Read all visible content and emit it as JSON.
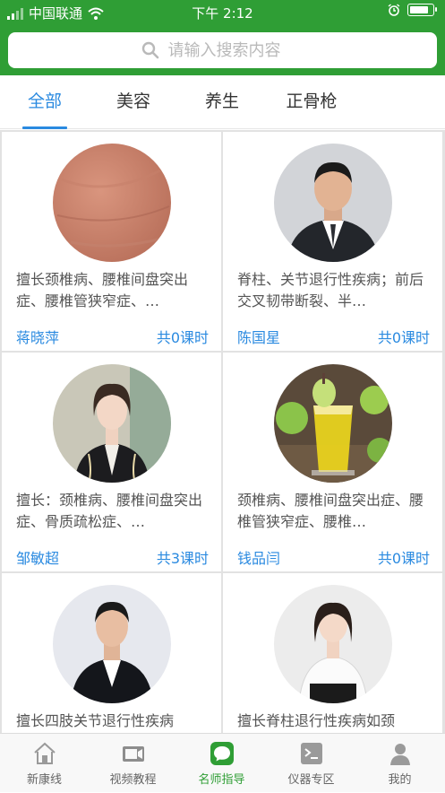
{
  "status_bar": {
    "carrier": "中国联通",
    "time": "下午 2:12"
  },
  "search": {
    "placeholder": "请输入搜索内容"
  },
  "tabs": [
    {
      "label": "全部",
      "active": true
    },
    {
      "label": "美容",
      "active": false
    },
    {
      "label": "养生",
      "active": false
    },
    {
      "label": "正骨枪",
      "active": false
    }
  ],
  "experts": [
    {
      "description": "擅长颈椎病、腰椎间盘突出症、腰椎管狭窄症、…",
      "name": "蒋晓萍",
      "hours": "共0课时",
      "avatar_icon": "skin-closeup-photo"
    },
    {
      "description": "脊柱、关节退行性疾病；前后交叉韧带断裂、半…",
      "name": "陈国星",
      "hours": "共0课时",
      "avatar_icon": "man-in-suit-photo"
    },
    {
      "description": "擅长：颈椎病、腰椎间盘突出症、骨质疏松症、…",
      "name": "邹敏超",
      "hours": "共3课时",
      "avatar_icon": "woman-in-suit-photo"
    },
    {
      "description": "颈椎病、腰椎间盘突出症、腰椎管狭窄症、腰椎…",
      "name": "钱品闫",
      "hours": "共0课时",
      "avatar_icon": "apple-juice-photo"
    },
    {
      "description": "擅长四肢关节退行性疾病",
      "name": "",
      "hours": "",
      "avatar_icon": "man-in-suit-photo"
    },
    {
      "description": "擅长脊柱退行性疾病如颈",
      "name": "",
      "hours": "",
      "avatar_icon": "woman-in-white-shirt-photo"
    }
  ],
  "tabbar": [
    {
      "label": "新康线",
      "icon": "home-icon",
      "active": false
    },
    {
      "label": "视频教程",
      "icon": "video-icon",
      "active": false
    },
    {
      "label": "名师指导",
      "icon": "chat-icon",
      "active": true
    },
    {
      "label": "仪器专区",
      "icon": "terminal-icon",
      "active": false
    },
    {
      "label": "我的",
      "icon": "person-icon",
      "active": false
    }
  ],
  "colors": {
    "header": "#2f9e35",
    "accent": "#2a8ae0",
    "active_tab_green": "#2f9e35"
  }
}
